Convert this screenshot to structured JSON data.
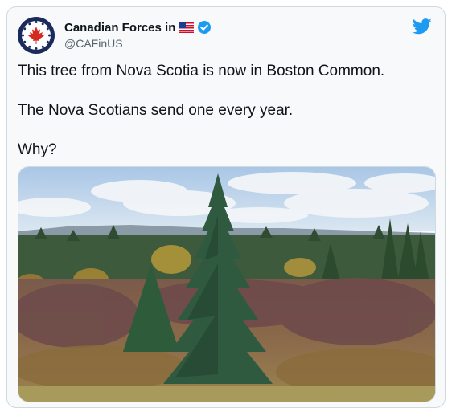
{
  "author": {
    "display_name": "Canadian Forces in",
    "handle": "@CAFinUS",
    "flag_icon": "us-flag-icon",
    "verified_icon": "verified-badge-icon",
    "avatar_icon": "canadian-forces-logo"
  },
  "brand": {
    "icon": "twitter-bird-icon",
    "color": "#1d9bf0"
  },
  "tweet": {
    "lines": [
      "This tree from Nova Scotia is now in Boston Common.",
      "The Nova Scotians send one every year.",
      "Why?"
    ]
  },
  "media": {
    "subject": "spruce-tree-photo"
  }
}
